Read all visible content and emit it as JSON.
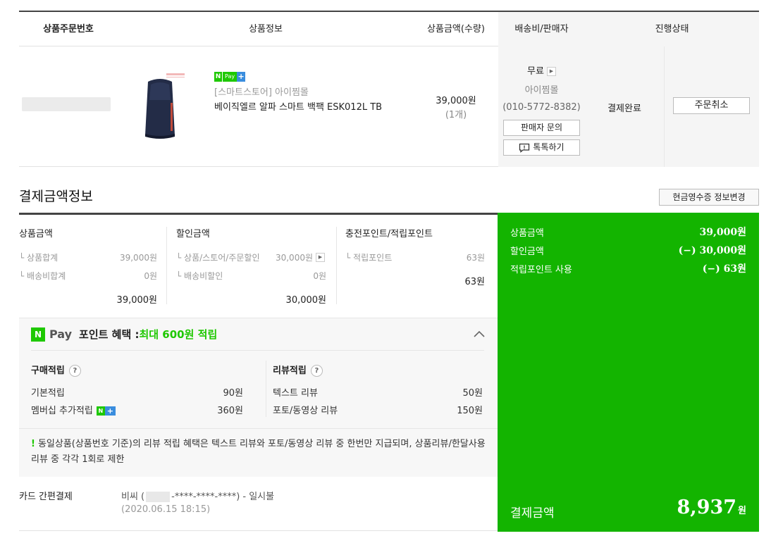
{
  "table_header": {
    "order_no": "상품주문번호",
    "product_info": "상품정보",
    "amount_qty": "상품금액(수량)",
    "shipping_seller": "배송비/판매자",
    "status": "진행상태"
  },
  "order": {
    "badge_n": "N",
    "badge_pay": "Pay",
    "badge_plus": "+",
    "store": "[스마트스토어] 아이찜몰",
    "product_name": "베이직엘르 알파 스마트 백팩 ESK012L TB",
    "price": "39,000원",
    "qty": "(1개)",
    "shipping": "무료",
    "seller": "아이찜몰",
    "phone": "(010-5772-8382)",
    "inquiry_button": "판매자 문의",
    "talk_button": "톡톡하기",
    "status": "결제완료",
    "cancel_button": "주문취소"
  },
  "payment": {
    "title": "결제금액정보",
    "receipt_button": "현금영수증 정보변경",
    "product_amount": {
      "head": "상품금액",
      "rows": [
        {
          "label": "└ 상품합계",
          "value": "39,000원"
        },
        {
          "label": "└ 배송비합계",
          "value": "0원"
        }
      ],
      "total": "39,000원"
    },
    "discount": {
      "head": "할인금액",
      "rows": [
        {
          "label": "└ 상품/스토어/주문할인",
          "value": "30,000원"
        },
        {
          "label": "└ 배송비할인",
          "value": "0원"
        }
      ],
      "total": "30,000원"
    },
    "points": {
      "head": "충전포인트/적립포인트",
      "rows": [
        {
          "label": "└ 적립포인트",
          "value": "63원"
        }
      ],
      "total": "63원"
    }
  },
  "benefit": {
    "n": "N",
    "pay": "Pay",
    "title": "포인트 혜택 : ",
    "max": "최대 600원 적립",
    "purchase": {
      "title": "구매적립",
      "q": "?",
      "rows": [
        {
          "label": "기본적립",
          "value": "90원"
        },
        {
          "label": "멤버십 추가적립",
          "value": "360원"
        }
      ]
    },
    "review": {
      "title": "리뷰적립",
      "q": "?",
      "rows": [
        {
          "label": "텍스트 리뷰",
          "value": "50원"
        },
        {
          "label": "포토/동영상 리뷰",
          "value": "150원"
        }
      ]
    },
    "notice_mark": "!",
    "notice": "동일상품(상품번호 기준)의 리뷰 적립 혜택은 텍스트 리뷰와 포토/동영상 리뷰 중 한번만 지급되며, 상품리뷰/한달사용 리뷰 중 각각 1회로 제한"
  },
  "card": {
    "label": "카드 간편결제",
    "prefix": "비씨 (",
    "masked": "-****-****-****) - 일시불",
    "date": "(2020.06.15 18:15)"
  },
  "summary": {
    "rows": [
      {
        "label": "상품금액",
        "value": "39,000원"
      },
      {
        "label": "할인금액",
        "value": "(−) 30,000원"
      },
      {
        "label": "적립포인트 사용",
        "value": "(−) 63원"
      }
    ],
    "final_label": "결제금액",
    "final_value": "8,937",
    "final_unit": "원"
  },
  "colors": {
    "npay_green": "#1ec800",
    "summary_green": "#13b400",
    "plus_blue": "#3a8dde"
  }
}
